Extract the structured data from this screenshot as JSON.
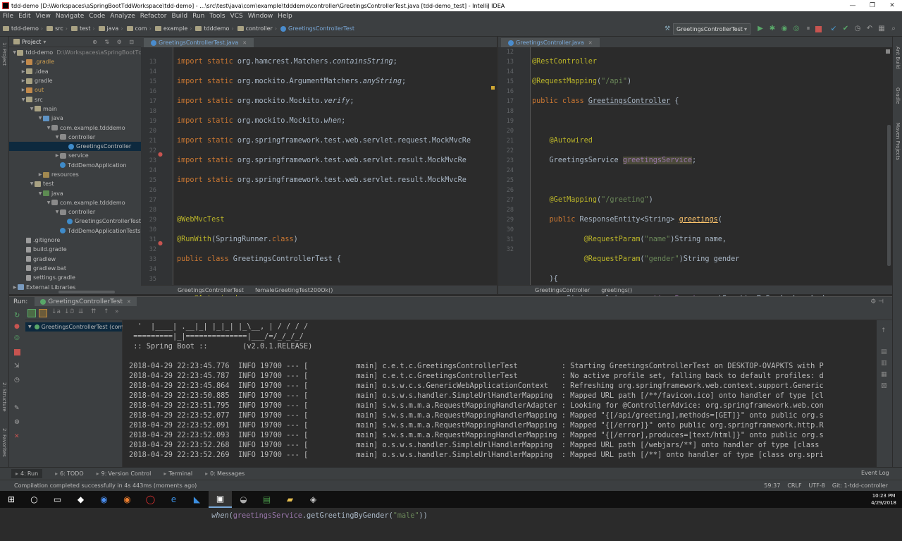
{
  "window": {
    "title": "tdd-demo [D:\\Workspaces\\aSpringBootTddWorkspace\\tdd-demo] - ...\\src\\test\\java\\com\\example\\tdddemo\\controller\\GreetingsControllerTest.java [tdd-demo_test] - IntelliJ IDEA",
    "minimize": "—",
    "maximize": "❐",
    "close": "✕"
  },
  "menu": [
    "File",
    "Edit",
    "View",
    "Navigate",
    "Code",
    "Analyze",
    "Refactor",
    "Build",
    "Run",
    "Tools",
    "VCS",
    "Window",
    "Help"
  ],
  "breadcrumbs": [
    "tdd-demo",
    "src",
    "test",
    "java",
    "com",
    "example",
    "tdddemo",
    "controller",
    "GreetingsControllerTest"
  ],
  "run_config": "GreetingsControllerTest",
  "project_panel": {
    "title": "Project",
    "tree": [
      {
        "label": "tdd-demo",
        "extra": "D:\\Workspaces\\aSpringBootTddT",
        "indent": 0,
        "icon": "folder",
        "arrow": "▼"
      },
      {
        "label": ".gradle",
        "indent": 1,
        "icon": "excl",
        "arrow": "▶"
      },
      {
        "label": ".idea",
        "indent": 1,
        "icon": "folder",
        "arrow": "▶"
      },
      {
        "label": "gradle",
        "indent": 1,
        "icon": "folder",
        "arrow": "▶"
      },
      {
        "label": "out",
        "indent": 1,
        "icon": "excl",
        "arrow": "▶"
      },
      {
        "label": "src",
        "indent": 1,
        "icon": "folder",
        "arrow": "▼"
      },
      {
        "label": "main",
        "indent": 2,
        "icon": "folder",
        "arrow": "▼"
      },
      {
        "label": "java",
        "indent": 3,
        "icon": "src",
        "arrow": "▼"
      },
      {
        "label": "com.example.tdddemo",
        "indent": 4,
        "icon": "pkg",
        "arrow": "▼"
      },
      {
        "label": "controller",
        "indent": 5,
        "icon": "pkg",
        "arrow": "▼"
      },
      {
        "label": "GreetingsController",
        "indent": 6,
        "icon": "cls",
        "arrow": "",
        "selected": true
      },
      {
        "label": "service",
        "indent": 5,
        "icon": "pkg",
        "arrow": "▶"
      },
      {
        "label": "TddDemoApplication",
        "indent": 5,
        "icon": "cls",
        "arrow": ""
      },
      {
        "label": "resources",
        "indent": 3,
        "icon": "res",
        "arrow": "▶"
      },
      {
        "label": "test",
        "indent": 2,
        "icon": "folder",
        "arrow": "▼"
      },
      {
        "label": "java",
        "indent": 3,
        "icon": "test",
        "arrow": "▼"
      },
      {
        "label": "com.example.tdddemo",
        "indent": 4,
        "icon": "pkg",
        "arrow": "▼"
      },
      {
        "label": "controller",
        "indent": 5,
        "icon": "pkg",
        "arrow": "▼"
      },
      {
        "label": "GreetingsControllerTest",
        "indent": 6,
        "icon": "cls",
        "arrow": ""
      },
      {
        "label": "TddDemoApplicationTests",
        "indent": 5,
        "icon": "cls",
        "arrow": ""
      },
      {
        "label": ".gitignore",
        "indent": 1,
        "icon": "file",
        "arrow": ""
      },
      {
        "label": "build.gradle",
        "indent": 1,
        "icon": "file",
        "arrow": ""
      },
      {
        "label": "gradlew",
        "indent": 1,
        "icon": "file",
        "arrow": ""
      },
      {
        "label": "gradlew.bat",
        "indent": 1,
        "icon": "file",
        "arrow": ""
      },
      {
        "label": "settings.gradle",
        "indent": 1,
        "icon": "file",
        "arrow": ""
      },
      {
        "label": "External Libraries",
        "indent": 0,
        "icon": "lib",
        "arrow": "▶"
      }
    ]
  },
  "left_strip": [
    "1: Project",
    "2: Structure",
    "2: Favorites"
  ],
  "right_strip": [
    "Ant Build",
    "Gradle",
    "Maven Projects"
  ],
  "editor_left": {
    "tab": "GreetingsControllerTest.java",
    "breadcrumb": [
      "GreetingsControllerTest",
      "femaleGreetingTest200Ok()"
    ],
    "line_numbers": [
      "",
      "13",
      "14",
      "15",
      "16",
      "17",
      "18",
      "19",
      "20",
      "21",
      "22",
      "23",
      "24",
      "25",
      "26",
      "27",
      "28",
      "29",
      "30",
      "31",
      "32",
      "33",
      "34",
      "35"
    ]
  },
  "editor_right": {
    "tab": "GreetingsController.java",
    "breadcrumb": [
      "GreetingsController",
      "greetings()"
    ],
    "line_numbers": [
      "12",
      "13",
      "14",
      "15",
      "16",
      "17",
      "18",
      "19",
      "20",
      "21",
      "22",
      "23",
      "24",
      "25",
      "26",
      "27",
      "28",
      "29",
      "30",
      "31",
      "32"
    ]
  },
  "run_panel": {
    "label": "Run:",
    "tab": "GreetingsControllerTest",
    "tree_item": "GreetingsControllerTest (com.e",
    "console": [
      "  '  |____| .__|_| |_|_| |_\\__, | / / / /",
      " =========|_|==============|___/=/_/_/_/",
      " :: Spring Boot ::        (v2.0.1.RELEASE)",
      "",
      "2018-04-29 22:23:45.776  INFO 19700 --- [           main] c.e.t.c.GreetingsControllerTest          : Starting GreetingsControllerTest on DESKTOP-OVAPKTS with P",
      "2018-04-29 22:23:45.787  INFO 19700 --- [           main] c.e.t.c.GreetingsControllerTest          : No active profile set, falling back to default profiles: d",
      "2018-04-29 22:23:45.864  INFO 19700 --- [           main] o.s.w.c.s.GenericWebApplicationContext   : Refreshing org.springframework.web.context.support.Generic",
      "2018-04-29 22:23:50.885  INFO 19700 --- [           main] o.s.w.s.handler.SimpleUrlHandlerMapping  : Mapped URL path [/**/favicon.ico] onto handler of type [cl",
      "2018-04-29 22:23:51.795  INFO 19700 --- [           main] s.w.s.m.m.a.RequestMappingHandlerAdapter : Looking for @ControllerAdvice: org.springframework.web.con",
      "2018-04-29 22:23:52.077  INFO 19700 --- [           main] s.w.s.m.m.a.RequestMappingHandlerMapping : Mapped \"{[/api/greeting],methods=[GET]}\" onto public org.s",
      "2018-04-29 22:23:52.091  INFO 19700 --- [           main] s.w.s.m.m.a.RequestMappingHandlerMapping : Mapped \"{[/error]}\" onto public org.springframework.http.R",
      "2018-04-29 22:23:52.093  INFO 19700 --- [           main] s.w.s.m.m.a.RequestMappingHandlerMapping : Mapped \"{[/error],produces=[text/html]}\" onto public org.s",
      "2018-04-29 22:23:52.268  INFO 19700 --- [           main] o.s.w.s.handler.SimpleUrlHandlerMapping  : Mapped URL path [/webjars/**] onto handler of type [class",
      "2018-04-29 22:23:52.269  INFO 19700 --- [           main] o.s.w.s.handler.SimpleUrlHandlerMapping  : Mapped URL path [/**] onto handler of type [class org.spri"
    ]
  },
  "bottom_tabs": [
    {
      "num": "4:",
      "label": "Run",
      "active": true
    },
    {
      "num": "6:",
      "label": "TODO",
      "active": false
    },
    {
      "num": "9:",
      "label": "Version Control",
      "active": false
    },
    {
      "num": "",
      "label": "Terminal",
      "active": false
    },
    {
      "num": "0:",
      "label": "Messages",
      "active": false
    }
  ],
  "event_log": "Event Log",
  "status": {
    "message": "Compilation completed successfully in 4s 443ms (moments ago)",
    "position": "59:37",
    "line_sep": "CRLF",
    "encoding": "UTF-8",
    "git": "Git: 1-tdd-controller"
  },
  "taskbar": {
    "time": "10:23 PM",
    "date": "4/29/2018"
  },
  "colors": {
    "keyword": "#cc7832",
    "annotation": "#bbb529",
    "string": "#6a8759",
    "field": "#9876aa",
    "background": "#2b2b2b",
    "panel": "#3c3f41"
  }
}
